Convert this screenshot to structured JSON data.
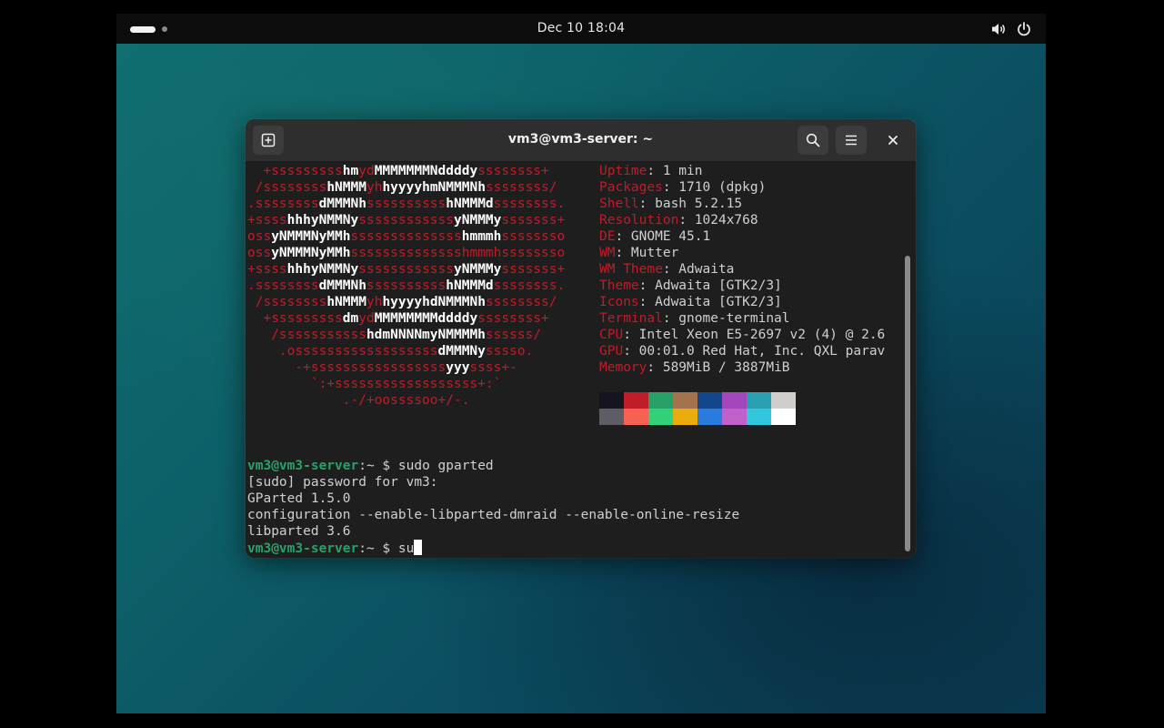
{
  "topbar": {
    "clock": "Dec 10  18:04",
    "icons": [
      "workspace-indicator",
      "volume-icon",
      "power-icon"
    ]
  },
  "window": {
    "title": "vm3@vm3-server: ~",
    "icons": [
      "new-tab-icon",
      "search-icon",
      "menu-icon",
      "close-icon"
    ]
  },
  "terminal": {
    "logo": [
      {
        "r1": "  +sssssssss",
        "w1": "hm",
        "r2": "yd",
        "w2": "MMMMMMMNddddy",
        "r3": "ssssssss+"
      },
      {
        "r1": " /ssssssss",
        "w1": "hNMMM",
        "r2": "yh",
        "w2": "hyyyyhmNMMMNh",
        "r3": "ssssssss/"
      },
      {
        "r1": ".ssssssss",
        "w1": "dMMMNh",
        "r2": "ssssssssss",
        "w2": "hNMMMd",
        "r3": "ssssssss."
      },
      {
        "r1": "+ssss",
        "w1": "hhhyNMMNy",
        "r2": "ssssssssssss",
        "w2": "yNMMMy",
        "r3": "sssssss+"
      },
      {
        "r1": "oss",
        "w1": "yNMMMNyMMh",
        "r2": "ssssssssssssss",
        "w2": "hmmmh",
        "r3": "ssssssso"
      },
      {
        "r1": "oss",
        "w1": "yNMMMNyMMh",
        "r2": "sssssssssssssshmmmhssssssso",
        "w2": "",
        "r3": ""
      },
      {
        "r1": "+ssss",
        "w1": "hhhyNMMNy",
        "r2": "ssssssssssss",
        "w2": "yNMMMy",
        "r3": "sssssss+"
      },
      {
        "r1": ".ssssssss",
        "w1": "dMMMNh",
        "r2": "ssssssssss",
        "w2": "hNMMMd",
        "r3": "ssssssss."
      },
      {
        "r1": " /ssssssss",
        "w1": "hNMMM",
        "r2": "yh",
        "w2": "hyyyyhdNMMMNh",
        "r3": "ssssssss/"
      },
      {
        "r1": "  +sssssssss",
        "w1": "dm",
        "r2": "yd",
        "w2": "MMMMMMMMddddy",
        "r3": "ssssssss+"
      },
      {
        "r1": "   /sssssssssss",
        "w1": "hdmNNNNmyNMMMMh",
        "r2": "ssssss/",
        "w2": "",
        "r3": ""
      },
      {
        "r1": "    .ossssssssssssssssss",
        "w1": "dMMMNy",
        "r2": "sssso.",
        "w2": "",
        "r3": ""
      },
      {
        "r1": "      -+sssssssssssssssss",
        "w1": "yyy",
        "r2": "ssss+-",
        "w2": "",
        "r3": ""
      },
      {
        "r1": "        `:+ssssssssssssssssss+:`",
        "w1": "",
        "r2": "",
        "w2": "",
        "r3": ""
      },
      {
        "r1": "            .-/+oossssoo+/-.",
        "w1": "",
        "r2": "",
        "w2": "",
        "r3": ""
      }
    ],
    "info": [
      {
        "label": "Uptime",
        "value": ": 1 min"
      },
      {
        "label": "Packages",
        "value": ": 1710 (dpkg)"
      },
      {
        "label": "Shell",
        "value": ": bash 5.2.15"
      },
      {
        "label": "Resolution",
        "value": ": 1024x768"
      },
      {
        "label": "DE",
        "value": ": GNOME 45.1"
      },
      {
        "label": "WM",
        "value": ": Mutter"
      },
      {
        "label": "WM Theme",
        "value": ": Adwaita"
      },
      {
        "label": "Theme",
        "value": ": Adwaita [GTK2/3]"
      },
      {
        "label": "Icons",
        "value": ": Adwaita [GTK2/3]"
      },
      {
        "label": "Terminal",
        "value": ": gnome-terminal"
      },
      {
        "label": "CPU",
        "value": ": Intel Xeon E5-2697 v2 (4) @ 2.6"
      },
      {
        "label": "GPU",
        "value": ": 00:01.0 Red Hat, Inc. QXL parav"
      },
      {
        "label": "Memory",
        "value": ": 589MiB / 3887MiB"
      }
    ],
    "palette_row1": [
      "#171421",
      "#c01c28",
      "#26a269",
      "#a2734c",
      "#12488b",
      "#a347ba",
      "#2aa1b3",
      "#d0cfcc"
    ],
    "palette_row2": [
      "#5e5c64",
      "#f66151",
      "#33d17a",
      "#e9ad0c",
      "#2a7bde",
      "#c061cb",
      "#33c7de",
      "#ffffff"
    ],
    "prompt_user": "vm3@vm3-server",
    "prompt_sep": ":",
    "prompt_path": "~",
    "prompt_dollar": "$",
    "cmd1": "sudo gparted",
    "out1": "[sudo] password for vm3:",
    "out2": "GParted 1.5.0",
    "out3": "configuration --enable-libparted-dmraid --enable-online-resize",
    "out4": "libparted 3.6",
    "cmd2": "su"
  }
}
